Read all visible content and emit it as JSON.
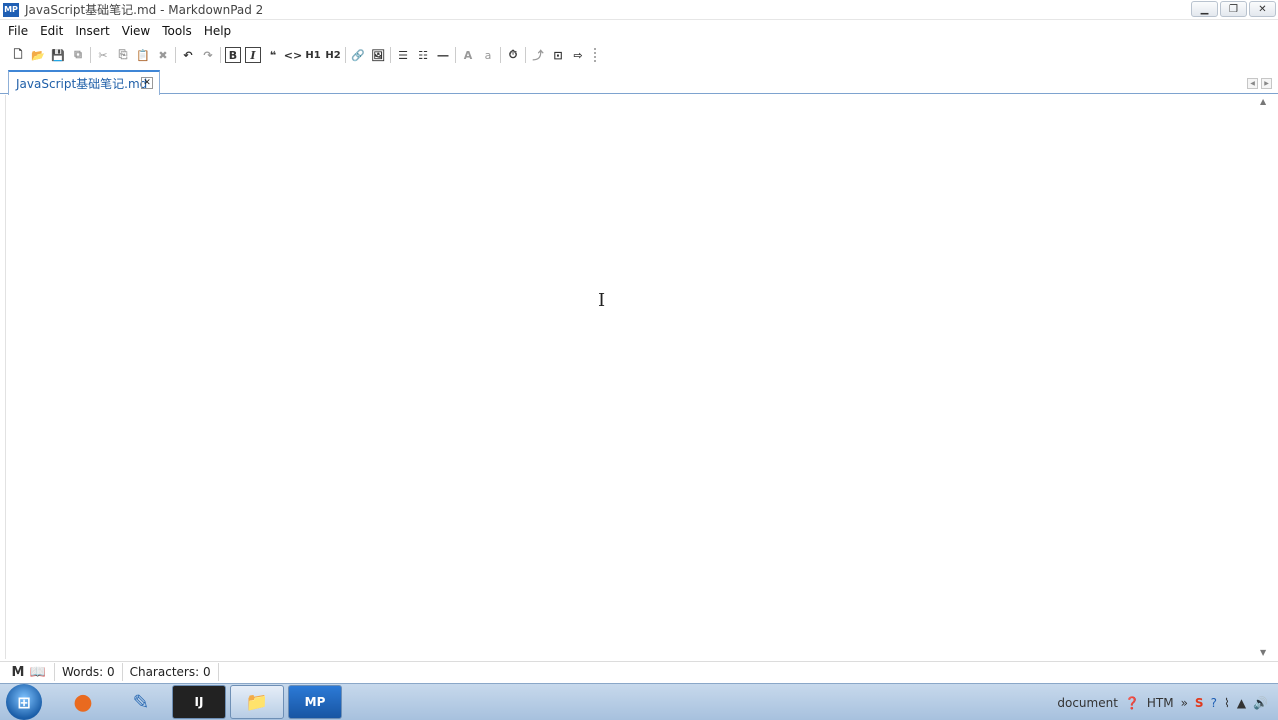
{
  "window": {
    "title": "JavaScript基础笔记.md - MarkdownPad 2",
    "logo_text": "MP",
    "controls": [
      "minimize",
      "restore",
      "close"
    ]
  },
  "menu": [
    "File",
    "Edit",
    "Insert",
    "View",
    "Tools",
    "Help"
  ],
  "toolbar": {
    "buttons": [
      {
        "name": "new-document",
        "glyph": "🗋"
      },
      {
        "name": "open-folder",
        "glyph": "📂"
      },
      {
        "name": "save",
        "glyph": "💾"
      },
      {
        "name": "save-all",
        "glyph": "⧉"
      },
      {
        "name": "cut",
        "glyph": "✂"
      },
      {
        "name": "copy",
        "glyph": "⎘"
      },
      {
        "name": "paste",
        "glyph": "📋"
      },
      {
        "name": "delete",
        "glyph": "✖"
      },
      {
        "name": "undo",
        "glyph": "↶"
      },
      {
        "name": "redo",
        "glyph": "↷"
      },
      {
        "name": "bold",
        "glyph": "B"
      },
      {
        "name": "italic",
        "glyph": "I"
      },
      {
        "name": "quote",
        "glyph": "❝"
      },
      {
        "name": "code",
        "glyph": "<>"
      },
      {
        "name": "heading1",
        "glyph": "H1"
      },
      {
        "name": "heading2",
        "glyph": "H2"
      },
      {
        "name": "link",
        "glyph": "🔗"
      },
      {
        "name": "image",
        "glyph": "🖼"
      },
      {
        "name": "bullet-list",
        "glyph": "☰"
      },
      {
        "name": "numbered-list",
        "glyph": "☷"
      },
      {
        "name": "horizontal-rule",
        "glyph": "―"
      },
      {
        "name": "uppercase",
        "glyph": "A"
      },
      {
        "name": "lowercase",
        "glyph": "a"
      },
      {
        "name": "timestamp",
        "glyph": "⏱"
      },
      {
        "name": "toggle",
        "glyph": "⤴"
      },
      {
        "name": "preview",
        "glyph": "⊡"
      },
      {
        "name": "export",
        "glyph": "⇨"
      }
    ]
  },
  "tabs": [
    {
      "label": "JavaScript基础笔记.md",
      "active": true
    }
  ],
  "editor": {
    "content": ""
  },
  "status": {
    "words_label": "Words: 0",
    "characters_label": "Characters: 0"
  },
  "taskbar": {
    "apps": [
      {
        "name": "color-app",
        "glyph": "●"
      },
      {
        "name": "paint-app",
        "glyph": "✎"
      },
      {
        "name": "intellij-app",
        "glyph": "IJ"
      },
      {
        "name": "explorer-app",
        "glyph": "📁"
      },
      {
        "name": "markdownpad-app",
        "glyph": "MP",
        "active": true
      }
    ],
    "tray_text": "document",
    "tray_lang": "HTM"
  }
}
